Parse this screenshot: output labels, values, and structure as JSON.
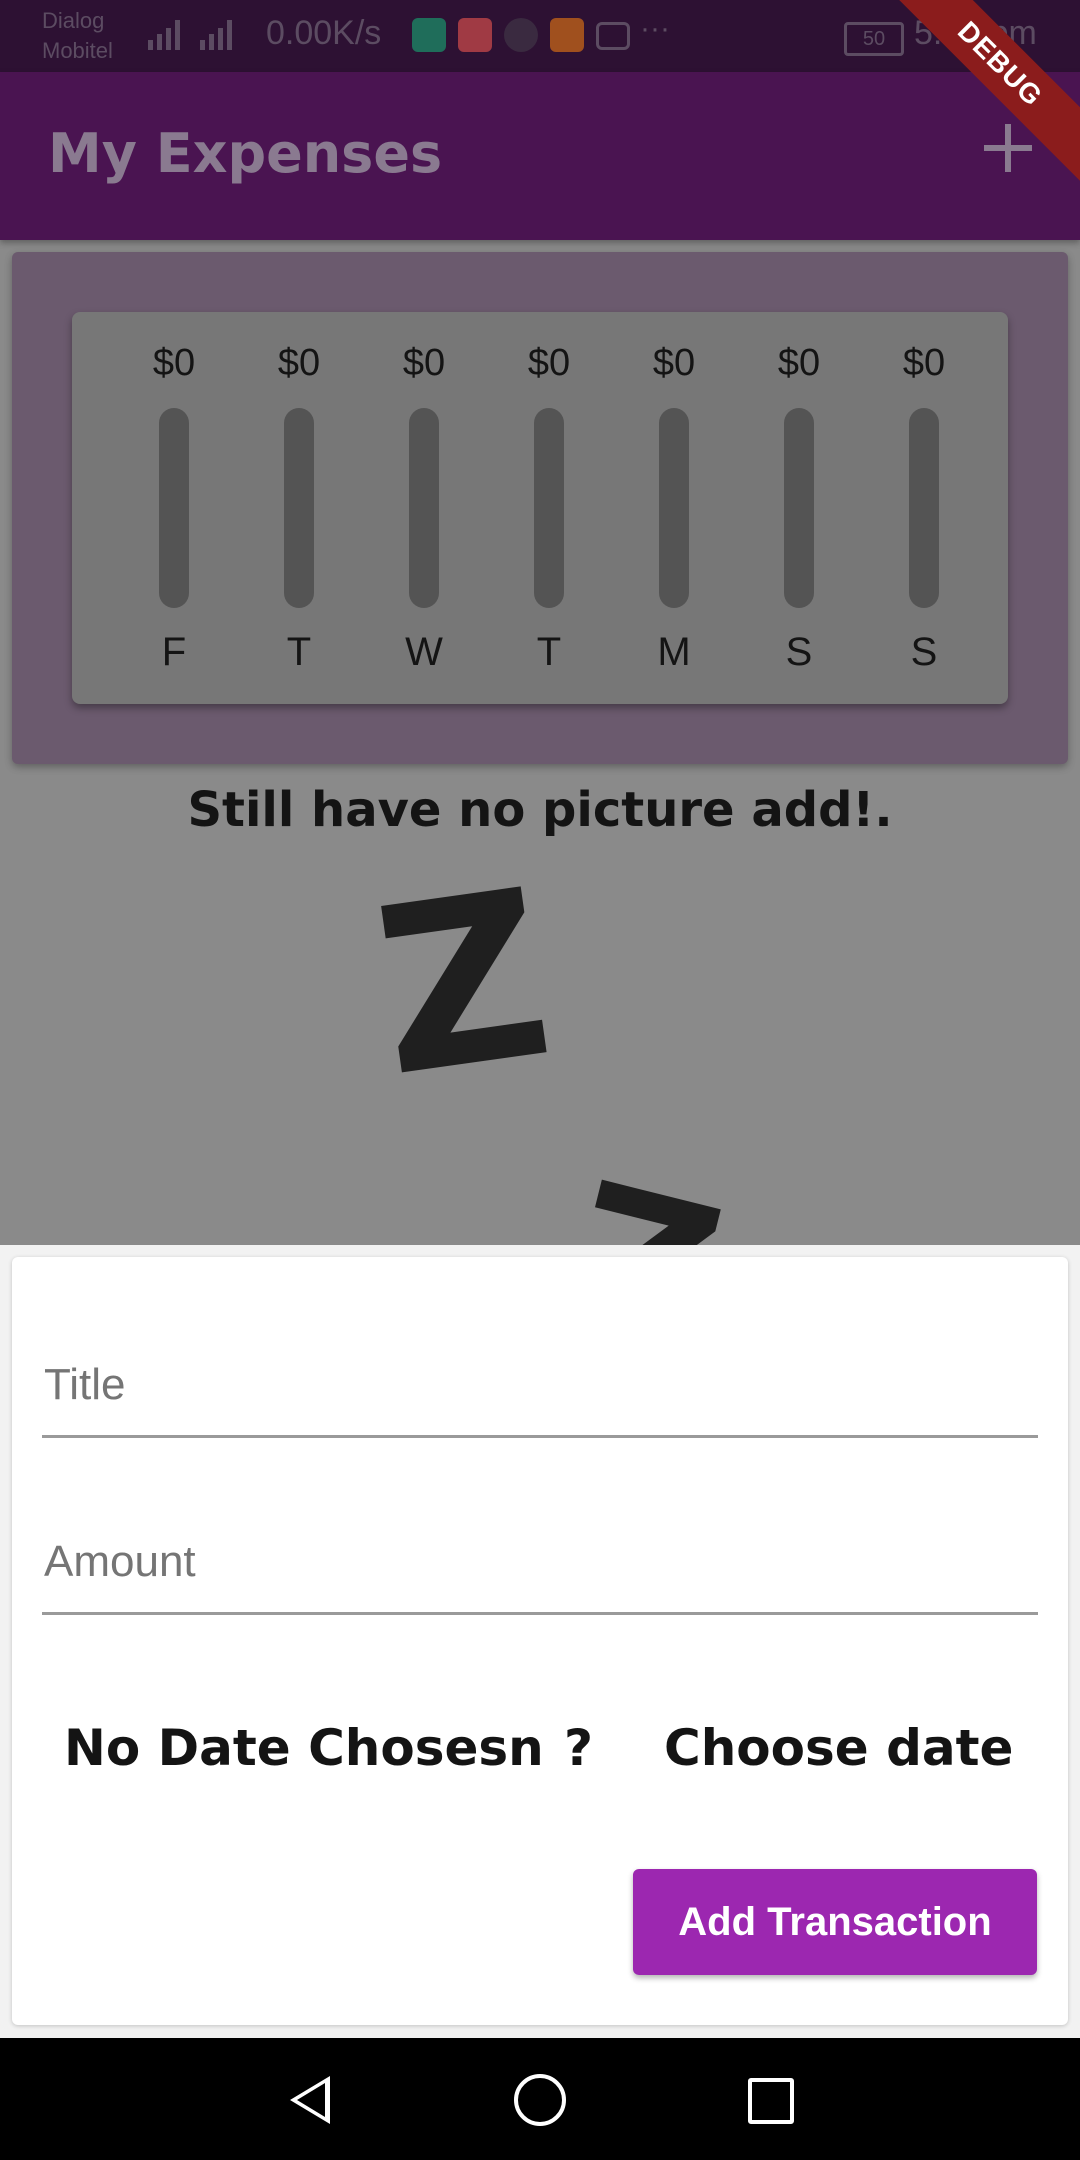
{
  "status_bar": {
    "carrier_line1": "Dialog",
    "carrier_line2": "Mobitel",
    "net_speed": "0.00K/s",
    "more": "···",
    "battery": "50",
    "time": "5:18 pm"
  },
  "app_bar": {
    "title": "My Expenses",
    "add_icon": "plus-icon",
    "debug_banner": "DEBUG"
  },
  "chart": {
    "bars": [
      {
        "day": "F",
        "amount": "$0",
        "fraction": 0
      },
      {
        "day": "T",
        "amount": "$0",
        "fraction": 0
      },
      {
        "day": "W",
        "amount": "$0",
        "fraction": 0
      },
      {
        "day": "T",
        "amount": "$0",
        "fraction": 0
      },
      {
        "day": "M",
        "amount": "$0",
        "fraction": 0
      },
      {
        "day": "S",
        "amount": "$0",
        "fraction": 0
      },
      {
        "day": "S",
        "amount": "$0",
        "fraction": 0
      }
    ]
  },
  "empty_state": {
    "message": "Still have no picture add!."
  },
  "form": {
    "title_placeholder": "Title",
    "title_value": "",
    "amount_placeholder": "Amount",
    "amount_value": "",
    "date_label": "No Date Chosesn",
    "date_separator": "?",
    "choose_date": "Choose date",
    "submit": "Add Transaction"
  },
  "colors": {
    "primary": "#9c27b0",
    "app_bar": "#4a1451"
  }
}
